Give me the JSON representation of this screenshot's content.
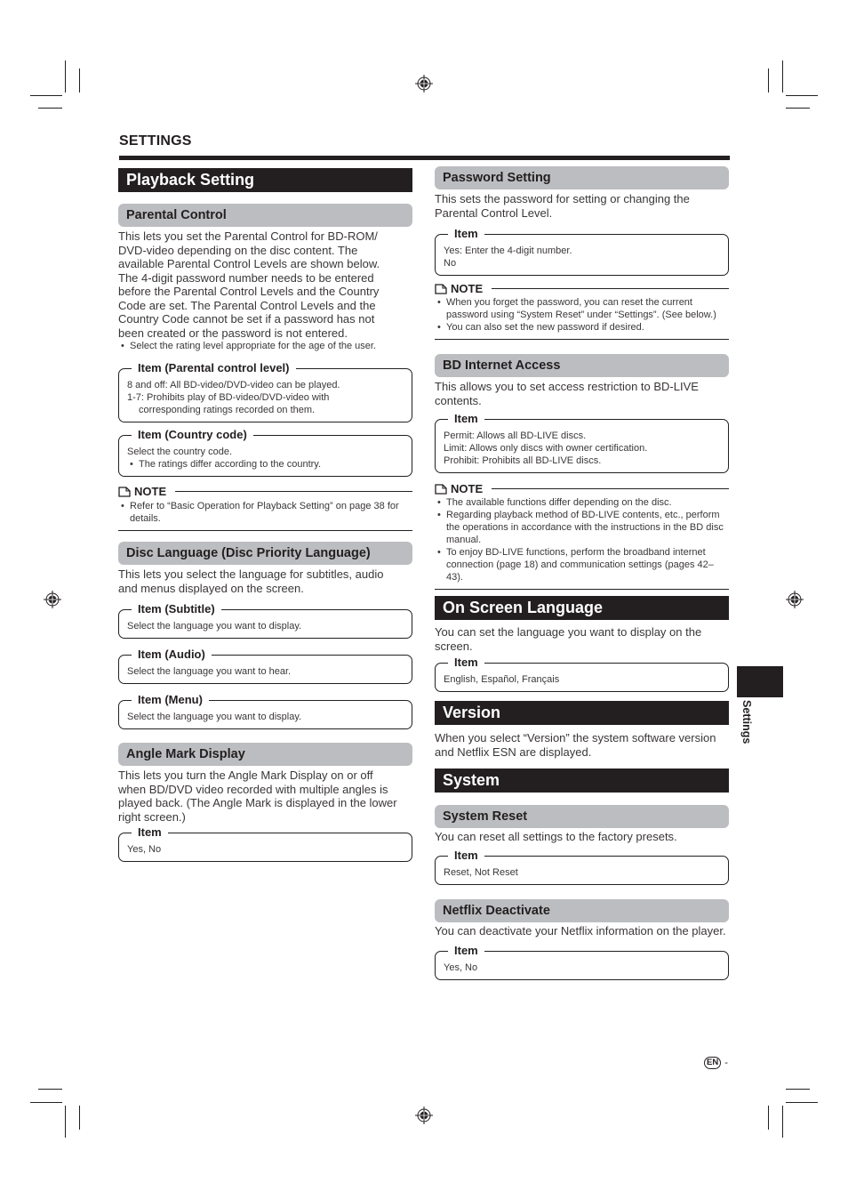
{
  "header": {
    "section": "SETTINGS"
  },
  "left": {
    "playback": {
      "title": "Playback Setting",
      "parental": {
        "title": "Parental Control",
        "desc": [
          "This lets you set the Parental Control for BD-ROM/",
          "DVD-video depending on the disc content. The",
          "available Parental Control Levels are shown below.",
          "The 4-digit password number needs to be entered",
          "before the Parental Control Levels and the Country",
          "Code are set. The Parental Control Levels and the",
          "Country Code cannot be set if a password has not",
          "been created or the password is not entered."
        ],
        "bullet": "Select the rating level appropriate for the age of the user.",
        "item_level": {
          "label": "Item (Parental control level)",
          "line1": "8 and off: All BD-video/DVD-video can be played.",
          "line2": "1-7: Prohibits play of BD-video/DVD-video with",
          "line3": "corresponding ratings recorded on them."
        },
        "item_country": {
          "label": "Item (Country code)",
          "line1": "Select the country code.",
          "bullet": "The ratings differ according to the country."
        },
        "note": {
          "label": "NOTE",
          "bullets": [
            "Refer to “Basic Operation for Playback Setting” on page 38 for details."
          ]
        }
      },
      "disc_language": {
        "title": "Disc Language (Disc Priority Language)",
        "desc": [
          "This lets you select the language for subtitles, audio",
          "and menus displayed on the screen."
        ],
        "items": [
          {
            "label": "Item (Subtitle)",
            "text": "Select the language you want to display."
          },
          {
            "label": "Item (Audio)",
            "text": "Select the language you want to hear."
          },
          {
            "label": "Item (Menu)",
            "text": "Select the language you want to display."
          }
        ]
      },
      "angle_mark": {
        "title": "Angle Mark Display",
        "desc": [
          "This lets you turn the Angle Mark Display on or off",
          "when BD/DVD video recorded with multiple angles is",
          "played back. (The Angle Mark is displayed in the lower",
          "right screen.)"
        ],
        "item": {
          "label": "Item",
          "text": "Yes, No"
        }
      }
    }
  },
  "right": {
    "password": {
      "title": "Password Setting",
      "desc": [
        "This sets the password for setting or changing the",
        "Parental Control Level."
      ],
      "item": {
        "label": "Item",
        "line1": "Yes: Enter the 4-digit number.",
        "line2": "No"
      },
      "note": {
        "label": "NOTE",
        "bullets": [
          "When you forget the password, you can reset the current password using “System Reset” under “Settings”. (See below.)",
          "You can also set the new password if desired."
        ]
      }
    },
    "bd_internet": {
      "title": "BD Internet Access",
      "desc": [
        "This allows you to set access restriction to BD-LIVE",
        "contents."
      ],
      "item": {
        "label": "Item",
        "line1": "Permit: Allows all BD-LIVE discs.",
        "line2": "Limit: Allows only discs with owner certification.",
        "line3": "Prohibit: Prohibits all BD-LIVE discs."
      },
      "note": {
        "label": "NOTE",
        "bullets": [
          "The available functions differ depending on the disc.",
          "Regarding playback method of BD-LIVE contents, etc., perform the operations in accordance with the instructions in the BD disc manual.",
          "To enjoy BD-LIVE functions, perform the broadband internet connection (page 18) and communication settings (pages 42–43)."
        ]
      }
    },
    "on_screen": {
      "title": "On Screen Language",
      "desc": [
        "You can set the language you want to display on the",
        "screen."
      ],
      "item": {
        "label": "Item",
        "text": "English, Español, Français"
      }
    },
    "version": {
      "title": "Version",
      "desc": [
        "When you select “Version” the system software version",
        "and Netflix ESN are displayed."
      ]
    },
    "system": {
      "title": "System",
      "reset": {
        "title": "System Reset",
        "desc": "You can reset all settings to the factory presets.",
        "item": {
          "label": "Item",
          "text": "Reset, Not Reset"
        }
      },
      "netflix": {
        "title": "Netflix Deactivate",
        "desc": "You can deactivate your Netflix information on the player.",
        "item": {
          "label": "Item",
          "text": "Yes, No"
        }
      }
    }
  },
  "side_tab": {
    "label": "Settings"
  },
  "footer": {
    "lang_badge": "EN",
    "page_suffix": "-"
  }
}
